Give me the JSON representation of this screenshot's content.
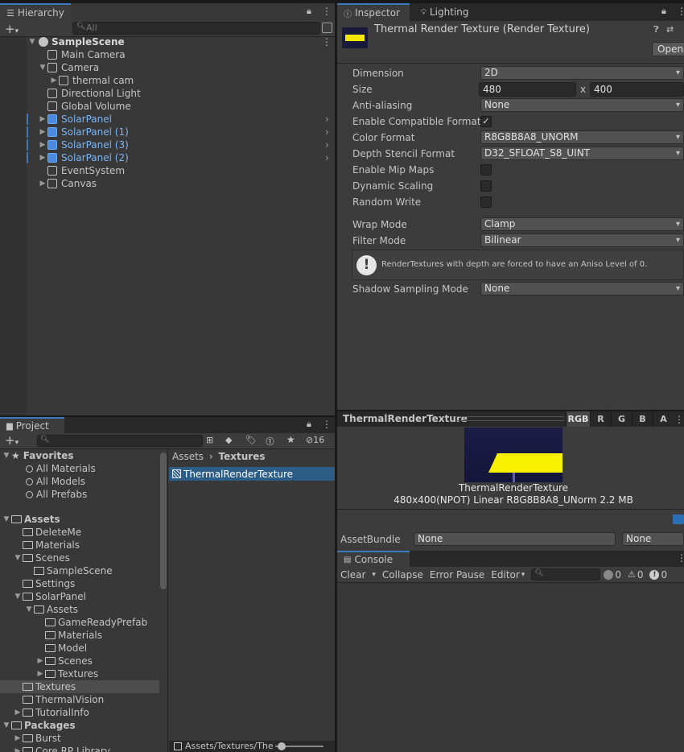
{
  "hierarchy": {
    "tab_label": "Hierarchy",
    "search_placeholder": "All",
    "scene_name": "SampleScene",
    "items": [
      {
        "label": "Main Camera",
        "depth": 1
      },
      {
        "label": "Camera",
        "depth": 1,
        "expanded": true
      },
      {
        "label": "thermal cam",
        "depth": 2
      },
      {
        "label": "Directional Light",
        "depth": 1
      },
      {
        "label": "Global Volume",
        "depth": 1
      },
      {
        "label": "SolarPanel",
        "depth": 1,
        "prefab": true
      },
      {
        "label": "SolarPanel (1)",
        "depth": 1,
        "prefab": true
      },
      {
        "label": "SolarPanel (3)",
        "depth": 1,
        "prefab": true
      },
      {
        "label": "SolarPanel (2)",
        "depth": 1,
        "prefab": true
      },
      {
        "label": "EventSystem",
        "depth": 1
      },
      {
        "label": "Canvas",
        "depth": 1
      }
    ]
  },
  "inspector": {
    "tab_label": "Inspector",
    "lighting_tab_label": "Lighting",
    "title": "Thermal Render Texture (Render Texture)",
    "open_button": "Open",
    "fields": {
      "dimension_label": "Dimension",
      "dimension_value": "2D",
      "size_label": "Size",
      "size_w": "480",
      "size_x": "x",
      "size_h": "400",
      "aa_label": "Anti-aliasing",
      "aa_value": "None",
      "compat_label": "Enable Compatible Format",
      "color_label": "Color Format",
      "color_value": "R8G8B8A8_UNORM",
      "depth_label": "Depth Stencil Format",
      "depth_value": "D32_SFLOAT_S8_UINT",
      "mip_label": "Enable Mip Maps",
      "dyn_label": "Dynamic Scaling",
      "rw_label": "Random Write",
      "wrap_label": "Wrap Mode",
      "wrap_value": "Clamp",
      "filter_label": "Filter Mode",
      "filter_value": "Bilinear",
      "info_text": "RenderTextures with depth are forced to have an Aniso Level of 0.",
      "shadow_label": "Shadow Sampling Mode",
      "shadow_value": "None"
    },
    "checks": {
      "compat": true,
      "mip": false,
      "dyn": false,
      "rw": false
    },
    "preview": {
      "header": "ThermalRenderTexture",
      "channels": [
        "RGB",
        "R",
        "G",
        "B",
        "A"
      ],
      "name": "ThermalRenderTexture",
      "info": "480x400(NPOT) Linear  R8G8B8A8_UNorm  2.2 MB"
    },
    "asset_bundle_label": "AssetBundle",
    "asset_bundle_value": "None",
    "asset_bundle_variant": "None"
  },
  "project": {
    "tab_label": "Project",
    "hidden_count": "16",
    "breadcrumb": [
      "Assets",
      "Textures"
    ],
    "selected_asset": "ThermalRenderTexture",
    "footer_path": "Assets/Textures/The",
    "favorites_label": "Favorites",
    "favorites": [
      "All Materials",
      "All Models",
      "All Prefabs"
    ],
    "assets_label": "Assets",
    "tree": [
      {
        "label": "DeleteMe",
        "depth": 1
      },
      {
        "label": "Materials",
        "depth": 1
      },
      {
        "label": "Scenes",
        "depth": 1,
        "expanded": true
      },
      {
        "label": "SampleScene",
        "depth": 2,
        "scene": true
      },
      {
        "label": "Settings",
        "depth": 1
      },
      {
        "label": "SolarPanel",
        "depth": 1,
        "expanded": true
      },
      {
        "label": "Assets",
        "depth": 2,
        "expanded": true
      },
      {
        "label": "GameReadyPrefab",
        "depth": 3
      },
      {
        "label": "Materials",
        "depth": 3
      },
      {
        "label": "Model",
        "depth": 3
      },
      {
        "label": "Scenes",
        "depth": 3,
        "collapsed": true
      },
      {
        "label": "Textures",
        "depth": 3,
        "collapsed": true
      },
      {
        "label": "Textures",
        "depth": 1,
        "selected": true
      },
      {
        "label": "ThermalVision",
        "depth": 1
      },
      {
        "label": "TutorialInfo",
        "depth": 1,
        "collapsed": true
      }
    ],
    "packages_label": "Packages",
    "packages": [
      "Burst",
      "Core RP Library"
    ]
  },
  "console": {
    "tab_label": "Console",
    "clear": "Clear",
    "collapse": "Collapse",
    "error_pause": "Error Pause",
    "editor": "Editor",
    "info_count": "0",
    "warn_count": "0",
    "error_count": "0"
  },
  "colors": {
    "accent": "#3a79bb",
    "prefab": "#7bb4f5",
    "selection": "#2c5d87"
  }
}
